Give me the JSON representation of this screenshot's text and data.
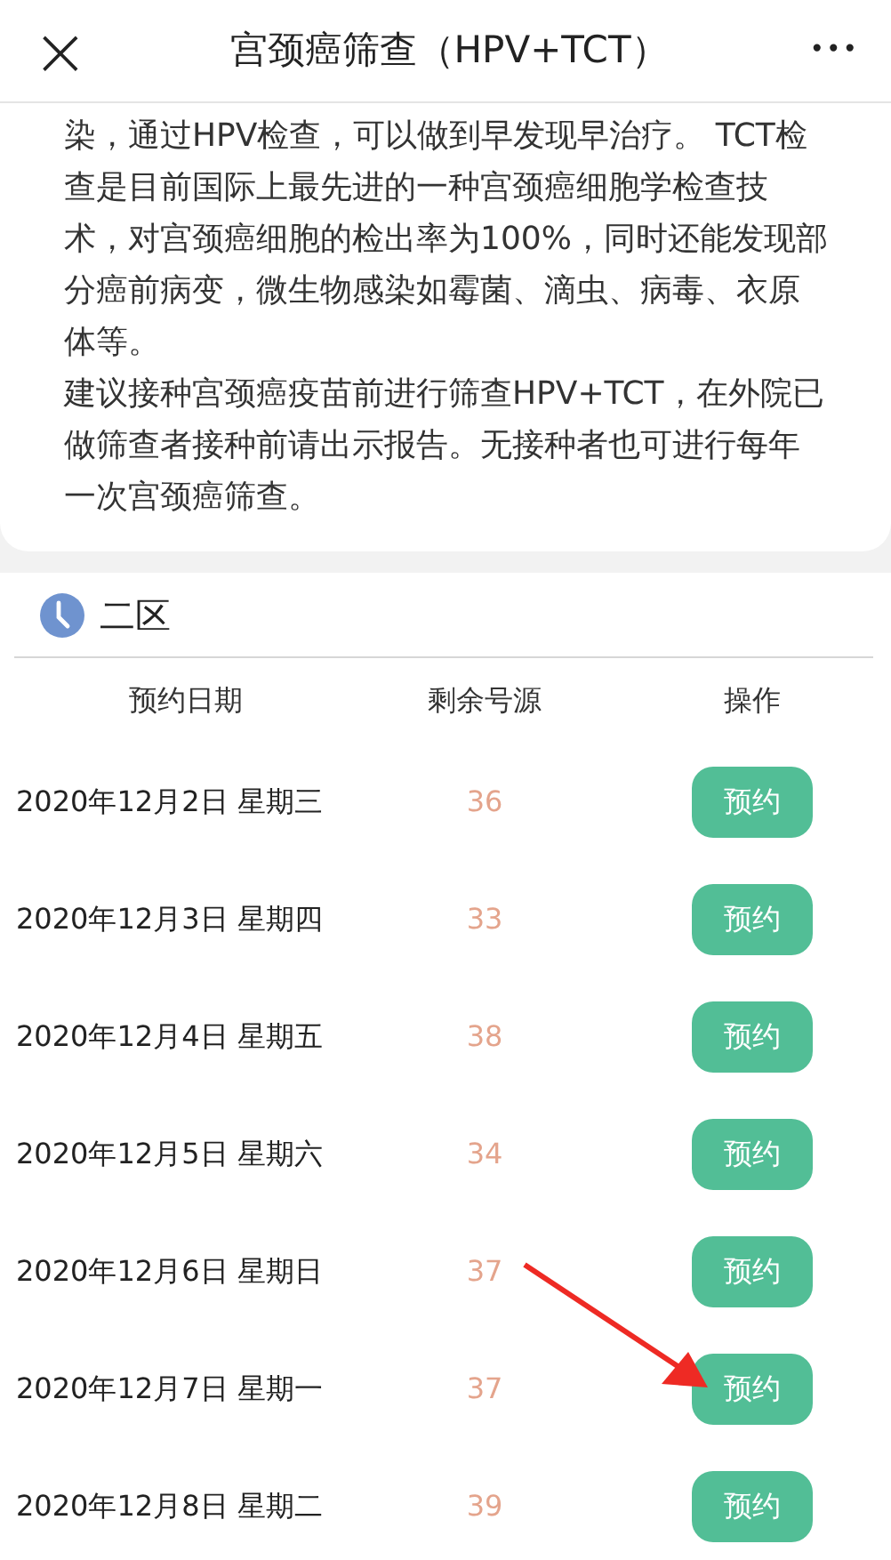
{
  "header": {
    "close": "×",
    "title": "宫颈癌筛查（HPV+TCT）",
    "more": "•••"
  },
  "intro_paragraphs": [
    "染，通过HPV检查，可以做到早发现早治疗。 TCT检查是目前国际上最先进的一种宫颈癌细胞学检查技术，对宫颈癌细胞的检出率为100%，同时还能发现部分癌前病变，微生物感染如霉菌、滴虫、病毒、衣原体等。",
    "建议接种宫颈癌疫苗前进行筛查HPV+TCT，在外院已做筛查者接种前请出示报告。无接种者也可进行每年一次宫颈癌筛查。"
  ],
  "zone": {
    "title": "二区"
  },
  "table": {
    "columns": [
      "预约日期",
      "剩余号源",
      "操作"
    ],
    "rows": [
      {
        "date": "2020年12月2日 星期三",
        "remaining": "36",
        "action": "预约"
      },
      {
        "date": "2020年12月3日 星期四",
        "remaining": "33",
        "action": "预约"
      },
      {
        "date": "2020年12月4日 星期五",
        "remaining": "38",
        "action": "预约"
      },
      {
        "date": "2020年12月5日 星期六",
        "remaining": "34",
        "action": "预约"
      },
      {
        "date": "2020年12月6日 星期日",
        "remaining": "37",
        "action": "预约"
      },
      {
        "date": "2020年12月7日 星期一",
        "remaining": "37",
        "action": "预约"
      },
      {
        "date": "2020年12月8日 星期二",
        "remaining": "39",
        "action": "预约"
      }
    ]
  }
}
